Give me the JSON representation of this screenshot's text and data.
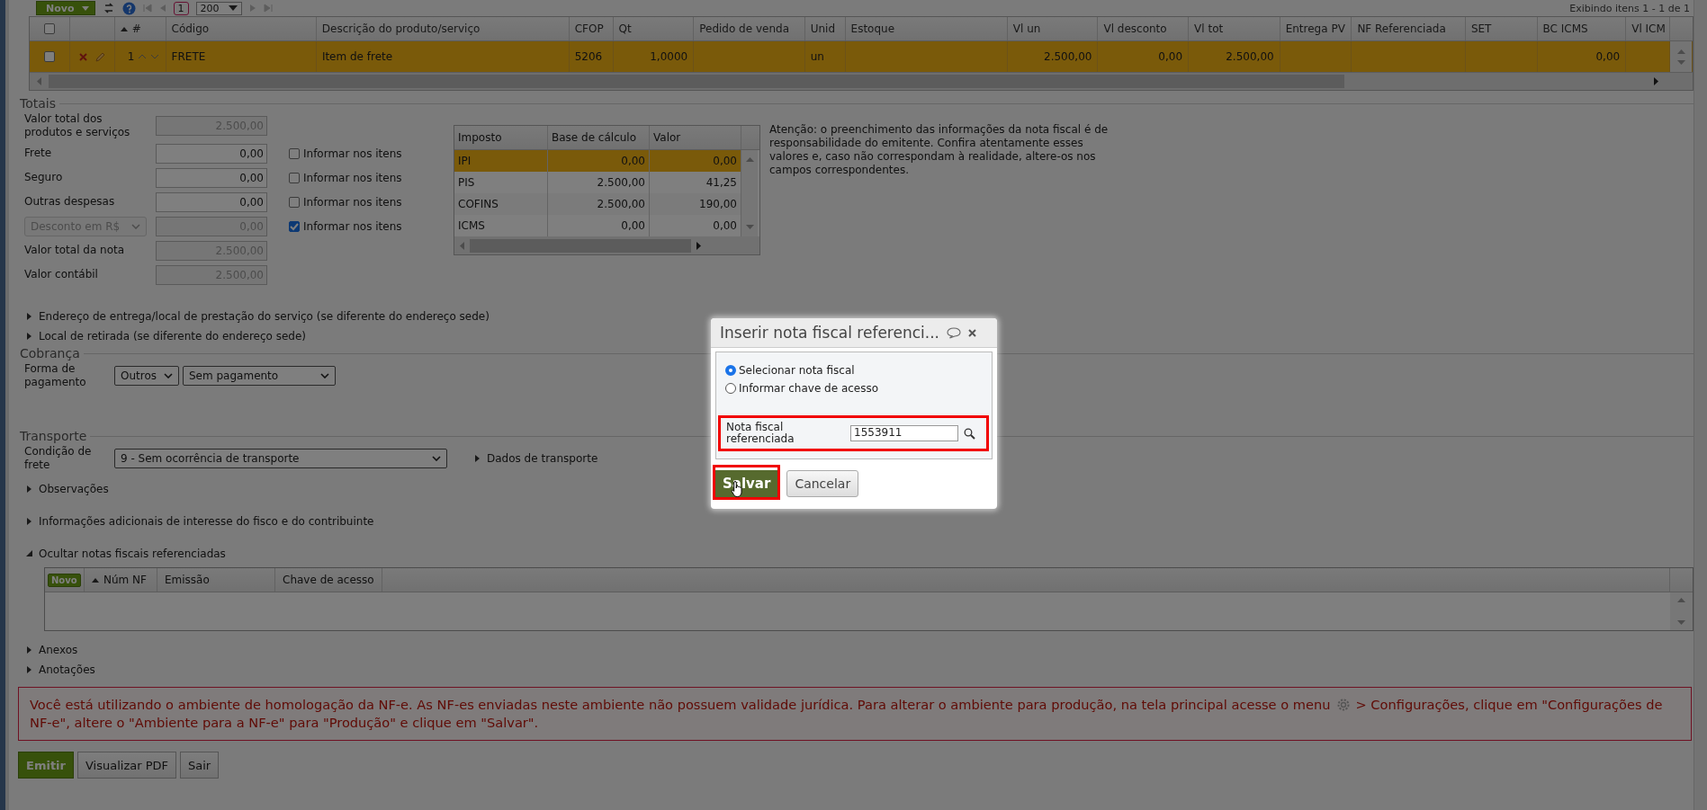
{
  "toolbar": {
    "new_button": "Novo",
    "page": "1",
    "page_size": "200",
    "range": "Exibindo itens 1 - 1 de 1"
  },
  "items_grid": {
    "all_checked": false,
    "columns": [
      {
        "label": "#",
        "sorted_ascending": true
      },
      {
        "label": "Código"
      },
      {
        "label": "Descrição do produto/serviço"
      },
      {
        "label": "CFOP"
      },
      {
        "label": "Qt"
      },
      {
        "label": "Pedido de venda"
      },
      {
        "label": "Unid"
      },
      {
        "label": "Estoque"
      },
      {
        "label": "Vl un"
      },
      {
        "label": "Vl desconto"
      },
      {
        "label": "Vl tot"
      },
      {
        "label": "Entrega PV"
      },
      {
        "label": "NF Referenciada"
      },
      {
        "label": "SET"
      },
      {
        "label": "BC ICMS"
      },
      {
        "label": "Vl ICM"
      }
    ],
    "rows": [
      {
        "selected": true,
        "checked": false,
        "cells": [
          "1",
          "FRETE",
          "Item de frete",
          "5206",
          "1,0000",
          null,
          "un",
          null,
          "2.500,00",
          "0,00",
          "2.500,00",
          null,
          null,
          null,
          "0,00",
          null
        ]
      }
    ]
  },
  "totals": {
    "title": "Totais",
    "fields": [
      {
        "kind": "label",
        "label": "Valor total dos produtos e serviços",
        "value": "2.500,00",
        "disabled": true
      },
      {
        "kind": "label",
        "label": "Frete",
        "value": "0,00",
        "disabled": false,
        "option": {
          "label": "Informar nos itens",
          "checked": false
        }
      },
      {
        "kind": "label",
        "label": "Seguro",
        "value": "0,00",
        "disabled": false,
        "option": {
          "label": "Informar nos itens",
          "checked": false
        }
      },
      {
        "kind": "label",
        "label": "Outras despesas",
        "value": "0,00",
        "disabled": false,
        "option": {
          "label": "Informar nos itens",
          "checked": false
        }
      },
      {
        "kind": "select",
        "label": "Desconto em R$",
        "value": "0,00",
        "disabled": true,
        "option": {
          "label": "Informar nos itens",
          "checked": true
        }
      },
      {
        "kind": "label",
        "label": "Valor total da nota",
        "value": "2.500,00",
        "disabled": true
      },
      {
        "kind": "label",
        "label": "Valor contábil",
        "value": "2.500,00",
        "disabled": true
      }
    ],
    "tax_table": {
      "columns": [
        "Imposto",
        "Base de cálculo",
        "Valor"
      ],
      "rows": [
        {
          "selected": true,
          "cells": [
            "IPI",
            "0,00",
            "0,00"
          ]
        },
        {
          "selected": false,
          "cells": [
            "PIS",
            "2.500,00",
            "41,25"
          ]
        },
        {
          "selected": false,
          "cells": [
            "COFINS",
            "2.500,00",
            "190,00"
          ]
        },
        {
          "selected": false,
          "cells": [
            "ICMS",
            "0,00",
            "0,00"
          ]
        }
      ]
    },
    "notice": "Atenção: o preenchimento das informações da nota fiscal é de responsabilidade do emitente. Confira atentamente esses valores e, caso não correspondam à realidade, altere-os nos campos correspondentes."
  },
  "sections_a": [
    {
      "label": "Endereço de entrega/local de prestação do serviço (se diferente do endereço sede)",
      "expanded": false
    },
    {
      "label": "Local de retirada (se diferente do endereço sede)",
      "expanded": false
    }
  ],
  "billing": {
    "title": "Cobrança",
    "label": "Forma de pagamento",
    "selects": [
      "Outros",
      "Sem pagamento"
    ]
  },
  "transport": {
    "title": "Transporte",
    "label": "Condição de frete",
    "select": "9 - Sem ocorrência de transporte",
    "details": {
      "label": "Dados de transporte",
      "expanded": false
    }
  },
  "sections_b": [
    {
      "label": "Observações",
      "expanded": false
    },
    {
      "label": "Informações adicionais de interesse do fisco e do contribuinte",
      "expanded": false
    },
    {
      "label": "Ocultar notas fiscais referenciadas",
      "expanded": true,
      "grid": {
        "new_button": "Novo",
        "columns": [
          {
            "label": "Núm NF",
            "sorted_ascending": true
          },
          {
            "label": "Emissão"
          },
          {
            "label": "Chave de acesso"
          }
        ]
      }
    }
  ],
  "sections_c": [
    {
      "label": "Anexos",
      "expanded": false
    },
    {
      "label": "Anotações",
      "expanded": false
    }
  ],
  "warning": {
    "before_icon": "Você está utilizando o ambiente de homologação da NF-e. As NF-es enviadas neste ambiente não possuem validade jurídica. Para alterar o ambiente para produção, na tela principal acesse o menu",
    "after_icon": "> Configurações, clique em \"Configurações de",
    "second_line": "NF-e\", altere o \"Ambiente para a NF-e\" para \"Produção\" e clique em \"Salvar\"."
  },
  "actions": [
    {
      "label": "Emitir",
      "kind": "primary"
    },
    {
      "label": "Visualizar PDF",
      "kind": "default"
    },
    {
      "label": "Sair",
      "kind": "default"
    }
  ],
  "dialog": {
    "title": "Inserir nota fiscal referenci...",
    "options": [
      {
        "label": "Selecionar nota fiscal",
        "selected": true
      },
      {
        "label": "Informar chave de acesso",
        "selected": false
      }
    ],
    "field": {
      "label": "Nota fiscal referenciada",
      "value": "1553911",
      "highlighted": true
    },
    "buttons": [
      {
        "label": "Salvar",
        "kind": "primary",
        "highlighted": true
      },
      {
        "label": "Cancelar",
        "kind": "default",
        "highlighted": false
      }
    ]
  }
}
